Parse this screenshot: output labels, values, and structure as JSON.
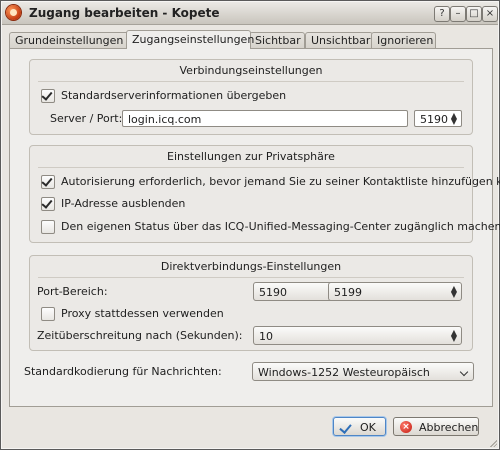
{
  "window": {
    "title": "Zugang bearbeiten - Kopete",
    "controls": {
      "help": "?",
      "minimize": "–",
      "maximize": "□",
      "close": "×"
    }
  },
  "tabs": [
    {
      "label": "Grundeinstellungen",
      "active": false
    },
    {
      "label": "Zugangseinstellungen",
      "active": true
    },
    {
      "label": "Sichtbar",
      "active": false
    },
    {
      "label": "Unsichtbar",
      "active": false
    },
    {
      "label": "Ignorieren",
      "active": false
    }
  ],
  "connection": {
    "title": "Verbindungseinstellungen",
    "send_default": {
      "label": "Standardserverinformationen übergeben",
      "checked": true
    },
    "server_port_label": "Server / Port:",
    "server_value": "login.icq.com",
    "port_value": "5190"
  },
  "privacy": {
    "title": "Einstellungen zur Privatsphäre",
    "items": [
      {
        "label": "Autorisierung erforderlich, bevor jemand Sie zu seiner Kontaktliste hinzufügen kann",
        "checked": true
      },
      {
        "label": "IP-Adresse ausblenden",
        "checked": true
      },
      {
        "label": "Den eigenen Status über das ICQ-Unified-Messaging-Center zugänglich machen",
        "checked": false
      }
    ]
  },
  "direct": {
    "title": "Direktverbindungs-Einstellungen",
    "port_range_label": "Port-Bereich:",
    "port_from": "5190",
    "port_to": "5199",
    "proxy": {
      "label": "Proxy stattdessen verwenden",
      "checked": false
    },
    "timeout_label": "Zeitüberschreitung nach (Sekunden):",
    "timeout_value": "10"
  },
  "encoding": {
    "label": "Standardkodierung für Nachrichten:",
    "value": "Windows-1252 Westeuropäisch"
  },
  "buttons": {
    "ok": "OK",
    "cancel": "Abbrechen"
  }
}
